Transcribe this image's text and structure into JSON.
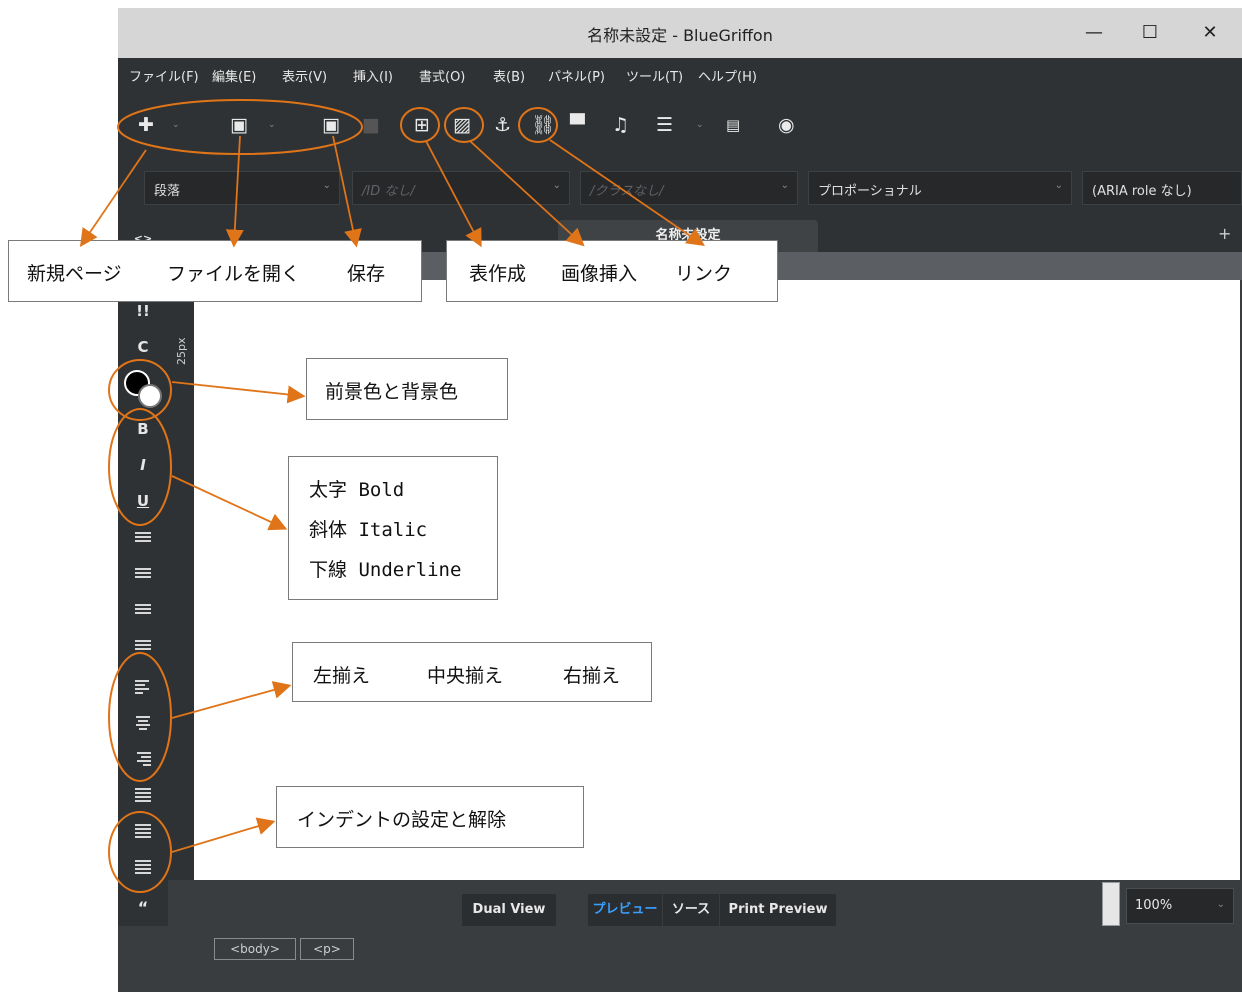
{
  "window": {
    "title": "名称未設定 - BlueGriffon",
    "controls": {
      "minimize": "—",
      "maximize": "☐",
      "close": "✕"
    }
  },
  "menu": [
    "ファイル(F)",
    "編集(E)",
    "表示(V)",
    "挿入(I)",
    "書式(O)",
    "表(B)",
    "パネル(P)",
    "ツール(T)",
    "ヘルプ(H)"
  ],
  "format_bar": {
    "paragraph": "段落",
    "id": "/ID なし/",
    "class": "/クラスなし/",
    "font": "プロポーショナル",
    "aria": "(ARIA role なし)"
  },
  "tab": {
    "title": "名称未設定",
    "add": "+"
  },
  "ruler": {
    "vertical_label": "25px"
  },
  "left_bar": {
    "source_tag": "<>",
    "important": "!!",
    "class": "C",
    "bold": "B",
    "italic": "I",
    "underline": "U",
    "quote": "“"
  },
  "bottom": {
    "dual_view": "Dual View",
    "preview": "プレビュー",
    "source": "ソース",
    "print_preview": "Print Preview",
    "zoom": "100%",
    "breadcrumbs": [
      "<body>",
      "<p>"
    ]
  },
  "annotations": {
    "toolbar_left": [
      "新規ページ",
      "ファイルを開く",
      "保存"
    ],
    "toolbar_right": [
      "表作成",
      "画像挿入",
      "リンク"
    ],
    "colors": "前景色と背景色",
    "text_style": [
      "太字 Bold",
      "斜体 Italic",
      "下線 Underline"
    ],
    "align": [
      "左揃え",
      "中央揃え",
      "右揃え"
    ],
    "indent": "インデントの設定と解除",
    "color": "#e07418"
  }
}
